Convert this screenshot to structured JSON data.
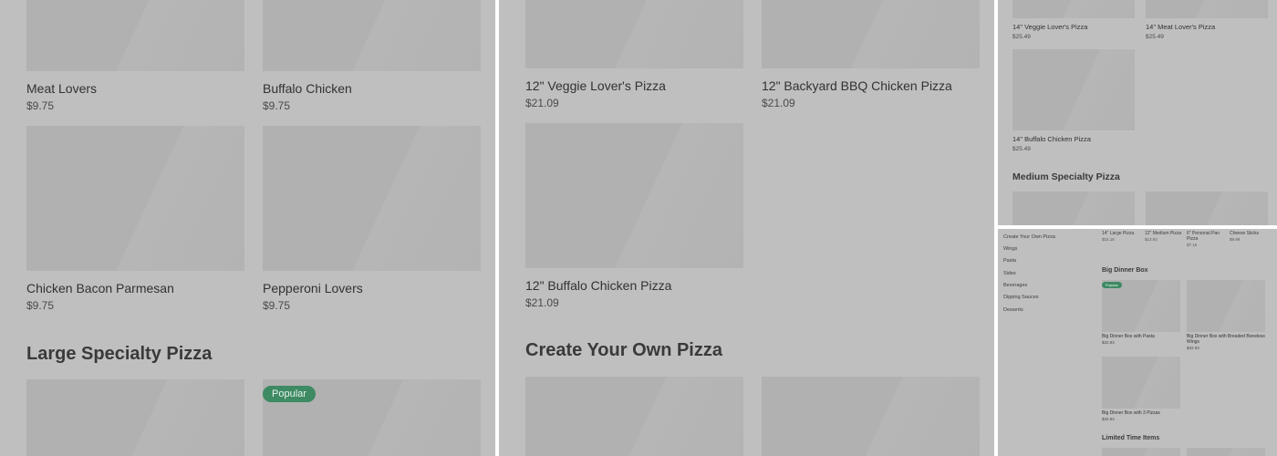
{
  "panel1": {
    "items": [
      {
        "name": "Meat Lovers",
        "price": "$9.75"
      },
      {
        "name": "Buffalo Chicken",
        "price": "$9.75"
      },
      {
        "name": "Chicken Bacon Parmesan",
        "price": "$9.75"
      },
      {
        "name": "Pepperoni Lovers",
        "price": "$9.75"
      }
    ],
    "section_title": "Large Specialty Pizza",
    "badge": "Popular"
  },
  "panel2": {
    "items": [
      {
        "name": "12\" Veggie Lover's Pizza",
        "price": "$21.09"
      },
      {
        "name": "12\" Backyard BBQ Chicken Pizza",
        "price": "$21.09"
      },
      {
        "name": "12\" Buffalo Chicken Pizza",
        "price": "$21.09"
      }
    ],
    "section_title": "Create Your Own Pizza"
  },
  "panel3": {
    "items": [
      {
        "name": "14\" Veggie Lover's Pizza",
        "price": "$25.49"
      },
      {
        "name": "14\" Meat Lover's Pizza",
        "price": "$25.49"
      },
      {
        "name": "14\" Buffalo Chicken Pizza",
        "price": "$25.49"
      }
    ],
    "section_title": "Medium Specialty Pizza"
  },
  "panel4": {
    "nav": [
      "Create Your Own Pizza",
      "Wings",
      "Pasta",
      "Sides",
      "Beverages",
      "Dipping Sauces",
      "Desserts"
    ],
    "top_items": [
      {
        "name": "14\" Large Pizza",
        "price": "$15.16"
      },
      {
        "name": "12\" Medium Pizza",
        "price": "$13.92"
      },
      {
        "name": "6\" Personal Pan Pizza",
        "price": "$7.15"
      },
      {
        "name": "Cheese Sticks",
        "price": "$9.99"
      }
    ],
    "section_title": "Big Dinner Box",
    "badge": "Popular",
    "items": [
      {
        "name": "Big Dinner Box with Pasta",
        "price": "$32.93"
      },
      {
        "name": "Big Dinner Box with Breaded Boneless Wings",
        "price": "$32.93"
      },
      {
        "name": "Big Dinner Box with 3 Pizzas",
        "price": "$32.94"
      }
    ],
    "section_title_2": "Limited Time Items"
  },
  "colors": {
    "overlay": "#bfbfbf",
    "placeholder": "#b1b1b1",
    "badge": "#3e8a63"
  }
}
